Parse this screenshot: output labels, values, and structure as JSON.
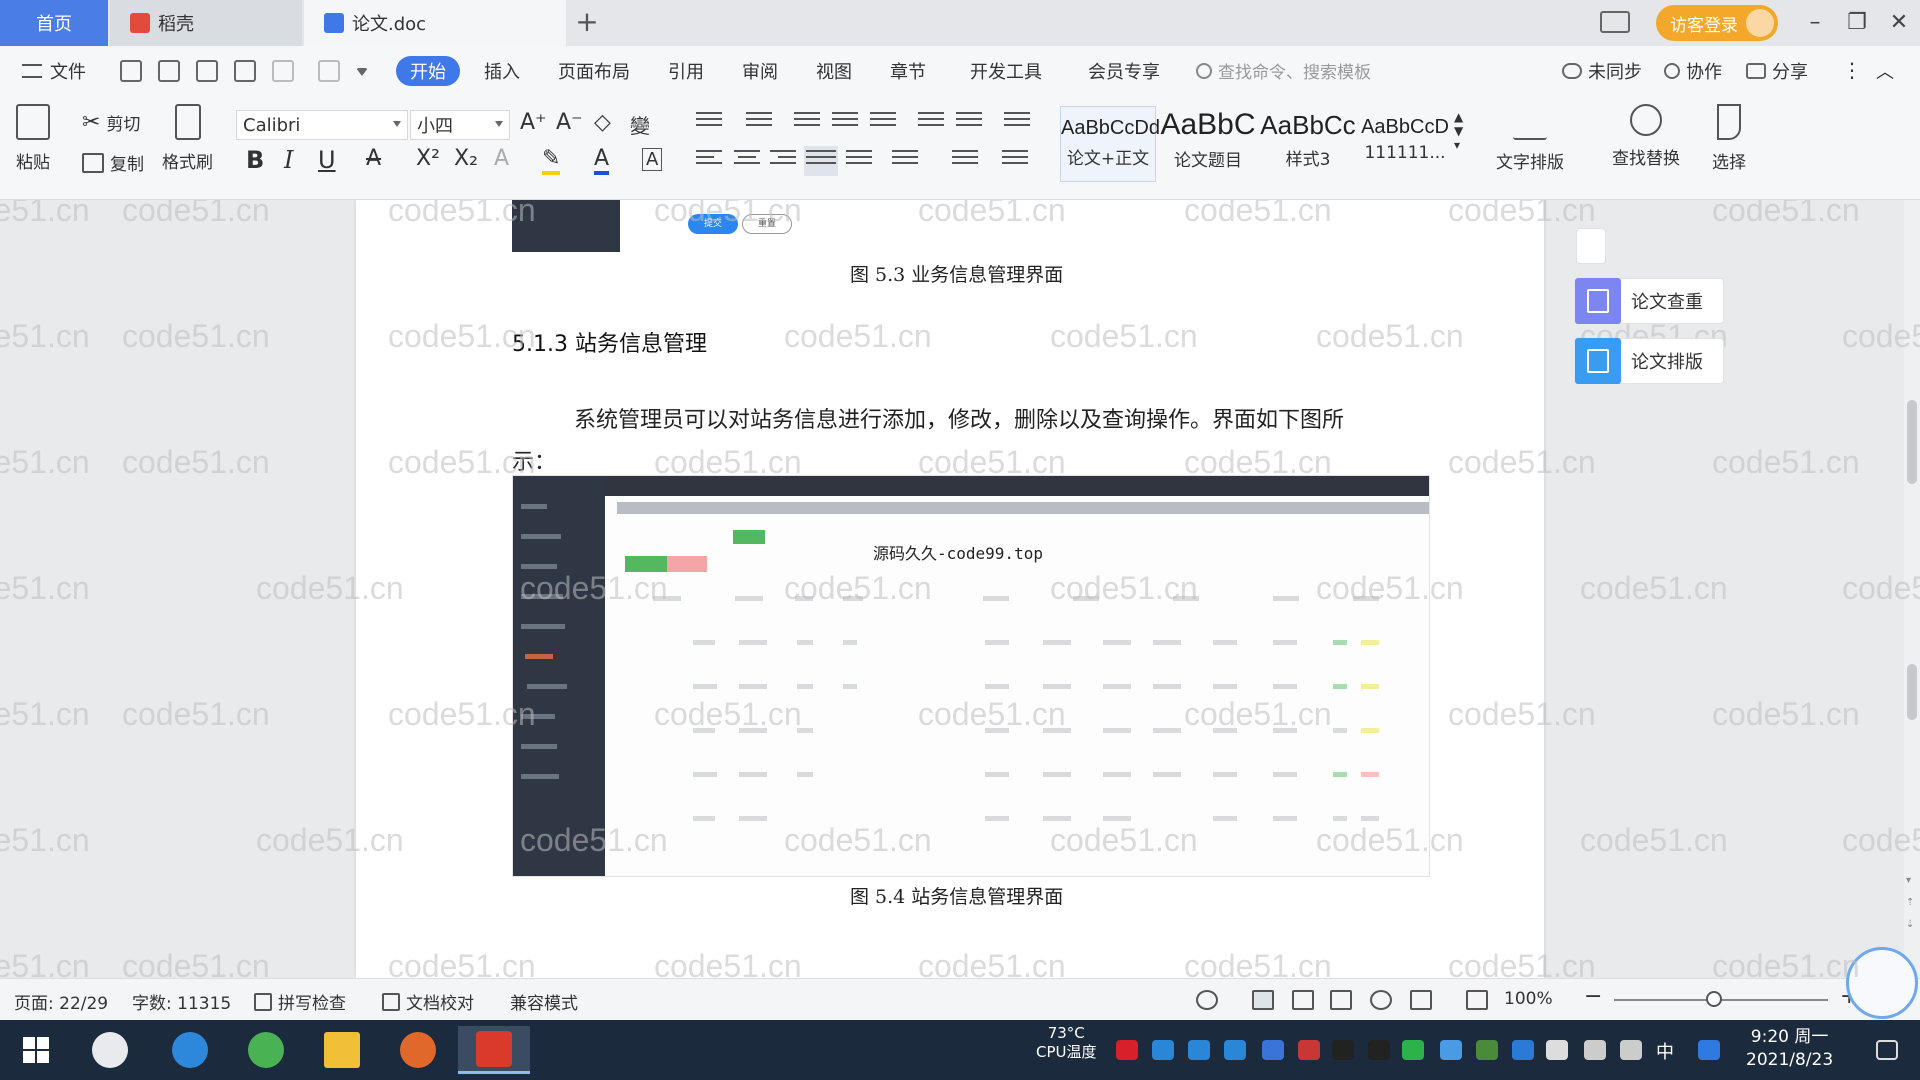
{
  "tabs": {
    "home": "首页",
    "daoke": "稻壳",
    "doc": "论文.doc",
    "login": "访客登录"
  },
  "menu": {
    "file": "文件",
    "items": [
      "开始",
      "插入",
      "页面布局",
      "引用",
      "审阅",
      "视图",
      "章节",
      "开发工具",
      "会员专享"
    ],
    "search_placeholder": "查找命令、搜索模板",
    "sync": "未同步",
    "collab": "协作",
    "share": "分享"
  },
  "toolbar": {
    "paste": "粘贴",
    "cut": "剪切",
    "copy": "复制",
    "format_painter": "格式刷",
    "font_name": "Calibri",
    "font_size": "小四",
    "styles": [
      {
        "sample": "AaBbCcDd",
        "name": "论文+正文"
      },
      {
        "sample": "AaBbC",
        "name": "论文题目"
      },
      {
        "sample": "AaBbCc",
        "name": "样式3"
      },
      {
        "sample": "AaBbCcD",
        "name": "111111..."
      }
    ],
    "text_layout": "文字排版",
    "find_replace": "查找替换",
    "select": "选择"
  },
  "document": {
    "btn_submit": "提交",
    "btn_reset": "重置",
    "caption_53": "图 5.3  业务信息管理界面",
    "heading": "5.1.3  站务信息管理",
    "paragraph_line1": "系统管理员可以对站务信息进行添加，修改，删除以及查询操作。界面如下图所",
    "paragraph_line2": "示：",
    "embedded_watermark": "源码久久-code99.top",
    "caption_54": "图 5.4  站务信息管理界面"
  },
  "watermark_text": "code51.cn",
  "side_panel": {
    "check": "论文查重",
    "layout": "论文排版"
  },
  "status": {
    "page": "页面: 22/29",
    "words": "字数: 11315",
    "spell": "拼写检查",
    "proof": "文档校对",
    "compat": "兼容模式",
    "zoom": "100%"
  },
  "taskbar": {
    "temp": "73°C",
    "cpu": "CPU温度",
    "ime": "中",
    "time": "9:20 周一",
    "date": "2021/8/23"
  },
  "colors": {
    "accent_blue": "#3f78e8",
    "login_orange": "#f3a72b",
    "taskbar": "#1c2a3e"
  }
}
